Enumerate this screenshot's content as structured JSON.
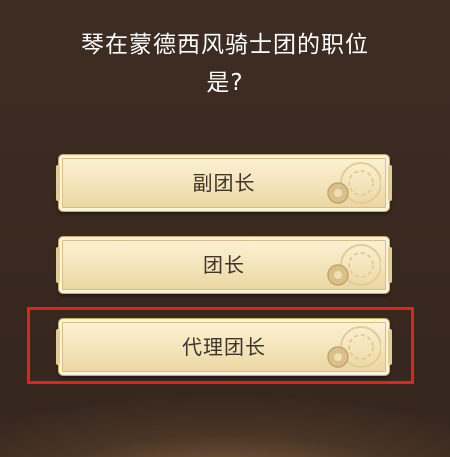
{
  "quiz": {
    "question_line1": "琴在蒙德西风骑士团的职位",
    "question_line2": "是?",
    "answers": [
      {
        "label": "副团长",
        "icon": "gear-icon"
      },
      {
        "label": "团长",
        "icon": "gear-icon"
      },
      {
        "label": "代理团长",
        "icon": "gear-icon",
        "highlighted": true
      }
    ]
  },
  "colors": {
    "background": "#3a2a21",
    "question_text": "#ffffff",
    "answer_fill": "#f3e3b8",
    "answer_text": "#3e352c",
    "highlight_border": "#e0241c"
  }
}
